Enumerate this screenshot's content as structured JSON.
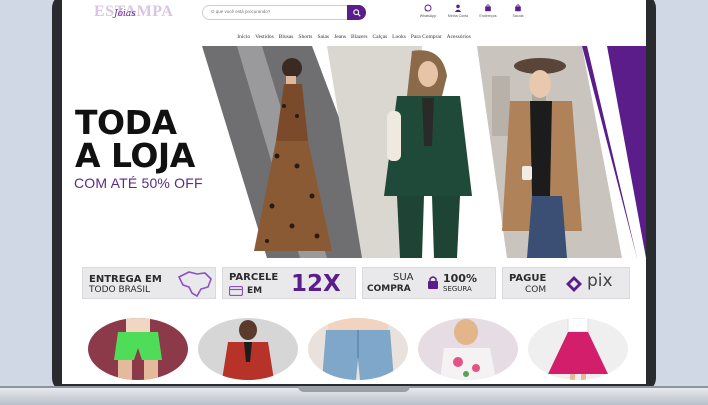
{
  "header": {
    "logo_text": "ESTAMPA",
    "logo_script": "Jóias",
    "search_placeholder": "O que você está procurando?",
    "icons": [
      {
        "label": "WhatsApp",
        "icon": "whatsapp-icon"
      },
      {
        "label": "Minha Conta",
        "icon": "user-icon"
      },
      {
        "label": "Endereços",
        "icon": "bag-icon"
      },
      {
        "label": "Sacola",
        "icon": "cart-icon"
      }
    ]
  },
  "nav": {
    "items": [
      "Início",
      "Vestidos",
      "Blusas",
      "Shorts",
      "Saias",
      "Jeans",
      "Blazers",
      "Calças",
      "Looks",
      "Para Comprar",
      "Acessórios"
    ]
  },
  "hero": {
    "title_line1": "TODA",
    "title_line2": "A LOJA",
    "subtitle": "COM ATÉ 50% OFF",
    "accent_color": "#5b1d8a"
  },
  "benefits": {
    "delivery_line1": "ENTREGA EM",
    "delivery_line2": "TODO BRASIL",
    "parcele_word": "PARCELE",
    "parcele_em": "EM",
    "parcele_times": "12X",
    "secure_sua": "SUA",
    "secure_compra": "COMPRA",
    "secure_percent": "100%",
    "secure_segura": "SEGURA",
    "pix_pague": "PAGUE",
    "pix_com": "COM",
    "pix_brand": "pix"
  },
  "colors": {
    "brand_purple": "#5b1d8a",
    "light_purple": "#8d4fc2"
  }
}
